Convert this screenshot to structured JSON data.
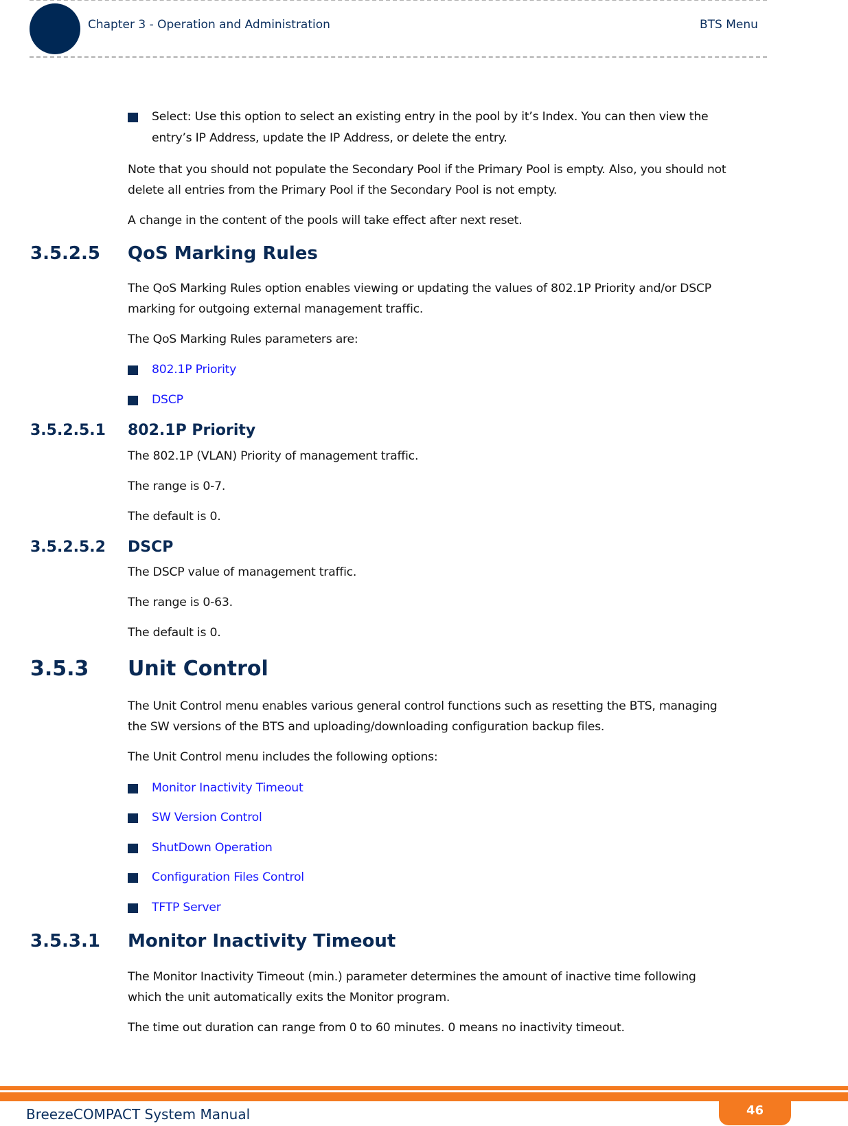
{
  "header": {
    "chapter": "Chapter 3 - Operation and Administration",
    "section": "BTS Menu"
  },
  "intro": {
    "select_bullet_line1": "Select: Use this option to select an existing entry in the pool by it’s Index. You can then view the",
    "select_bullet_line2": "entry’s IP Address, update the IP Address, or delete the entry.",
    "note_line1": "Note that you should not populate the Secondary Pool if the Primary Pool is empty. Also, you should not",
    "note_line2": "delete all entries from the Primary Pool if the Secondary Pool is not empty.",
    "change": "A change in the content of the pools will take effect after next reset."
  },
  "qos": {
    "number": "3.5.2.5",
    "title": "QoS Marking Rules",
    "desc_line1": "The QoS Marking Rules option enables viewing or updating the values of 802.1P Priority and/or DSCP",
    "desc_line2": "marking for outgoing external management traffic.",
    "params_intro": "The QoS Marking Rules parameters are:",
    "links": [
      "802.1P Priority",
      "DSCP"
    ]
  },
  "priority": {
    "number": "3.5.2.5.1",
    "title": "802.1P Priority",
    "desc": "The 802.1P (VLAN) Priority of management traffic.",
    "range": "The range is 0-7.",
    "default": "The default is 0."
  },
  "dscp": {
    "number": "3.5.2.5.2",
    "title": "DSCP",
    "desc": "The DSCP value of management traffic.",
    "range": "The range is 0-63.",
    "default": "The default is 0."
  },
  "unit_control": {
    "number": "3.5.3",
    "title": "Unit Control",
    "desc_line1": "The Unit Control menu enables various general control functions such as resetting the BTS, managing",
    "desc_line2": "the SW versions of the BTS and uploading/downloading configuration backup files.",
    "options_intro": "The Unit Control menu includes the following options:",
    "links": [
      "Monitor Inactivity Timeout",
      "SW Version Control",
      "ShutDown Operation",
      "Configuration Files Control",
      "TFTP Server"
    ]
  },
  "monitor": {
    "number": "3.5.3.1",
    "title": "Monitor Inactivity Timeout",
    "desc_line1": "The Monitor Inactivity Timeout (min.) parameter determines the amount of inactive time following",
    "desc_line2": "which the unit automatically exits the Monitor program.",
    "range": "The time out duration can range from 0 to 60 minutes. 0 means no inactivity timeout."
  },
  "footer": {
    "manual_title": "BreezeCOMPACT System Manual",
    "page_number": "46"
  },
  "colors": {
    "brand_navy": "#0a2a55",
    "accent_orange": "#f47a20",
    "link_blue": "#1a1aff"
  }
}
